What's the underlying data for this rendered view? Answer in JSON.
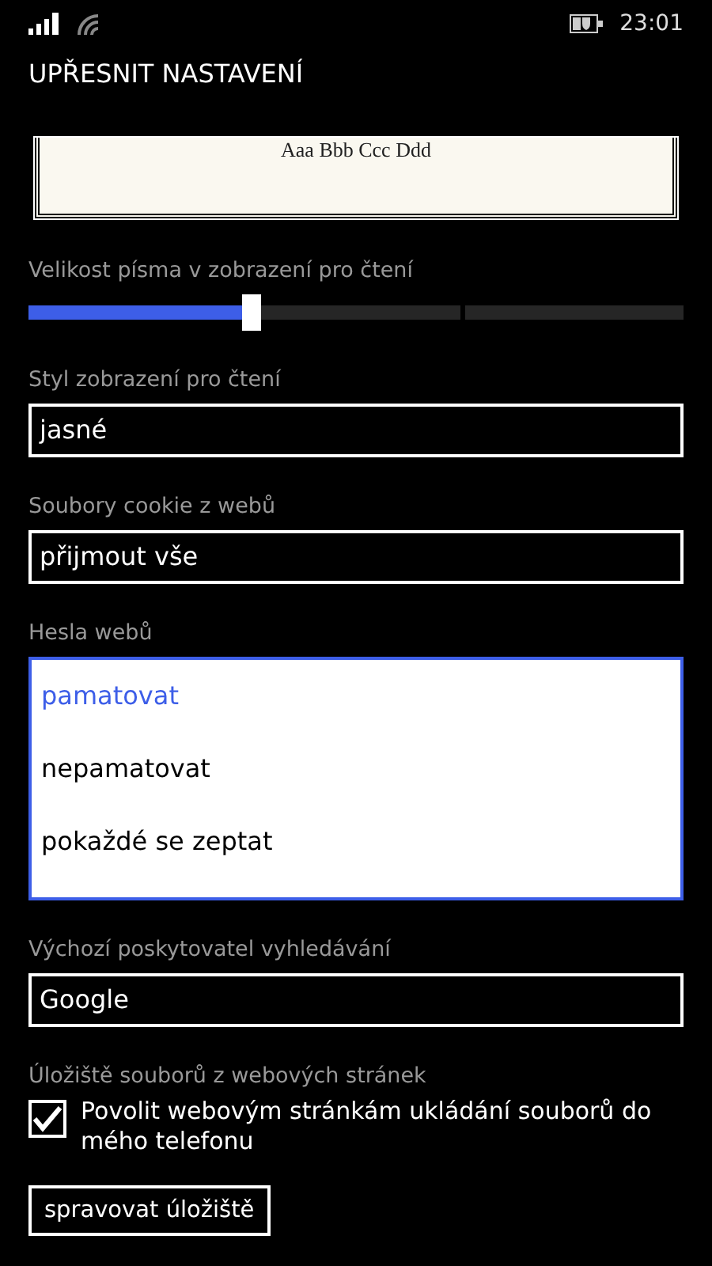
{
  "status_bar": {
    "time": "23:01"
  },
  "title": "UPŘESNIT NASTAVENÍ",
  "preview": {
    "text": "Aaa Bbb Ccc Ddd"
  },
  "settings": [
    {
      "kind": "slider",
      "label": "Velikost písma v zobrazení pro čtení",
      "level": 0.34
    },
    {
      "kind": "select",
      "label": "Styl zobrazení pro čtení",
      "value": "jasné"
    },
    {
      "kind": "select",
      "label": "Soubory cookie z webů",
      "value": "přijmout vše"
    },
    {
      "kind": "list",
      "label": "Hesla webů",
      "options": [
        {
          "label": "pamatovat",
          "selected": true
        },
        {
          "label": "nepamatovat",
          "selected": false
        },
        {
          "label": "pokaždé se zeptat",
          "selected": false
        }
      ]
    },
    {
      "kind": "select",
      "label": "Výchozí poskytovatel vyhledávání",
      "value": "Google"
    },
    {
      "kind": "checkbox",
      "label": "Úložiště souborů z webových stránek",
      "text": "Povolit webovým stránkám ukládání souborů do mého telefonu",
      "checked": true
    },
    {
      "kind": "button",
      "text": "spravovat úložiště"
    }
  ]
}
